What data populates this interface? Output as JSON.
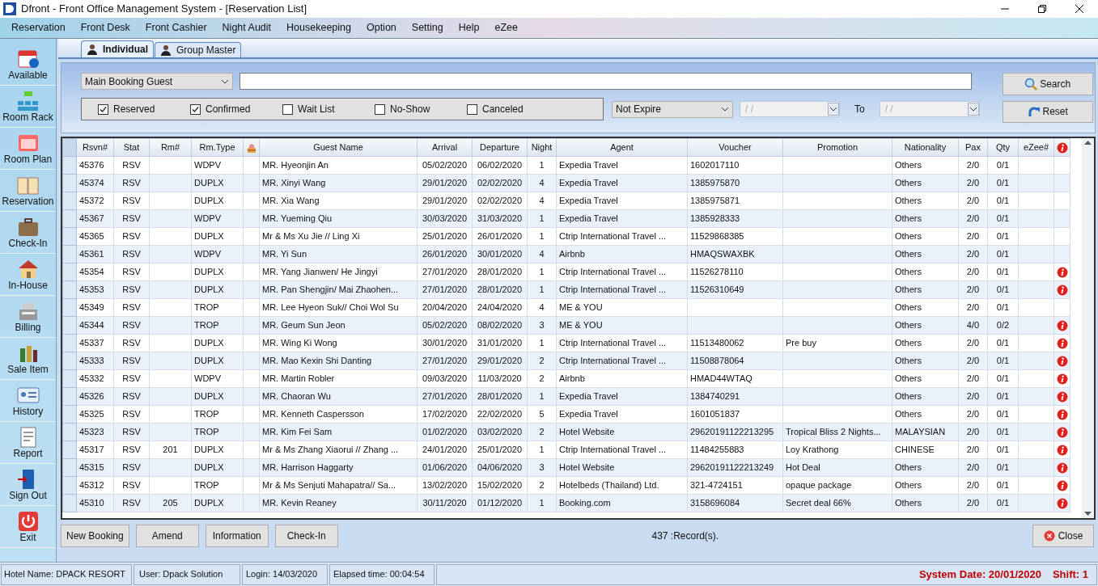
{
  "window": {
    "title": "Dfront - Front Office Management System - [Reservation List]"
  },
  "menu": [
    "Reservation",
    "Front Desk",
    "Front Cashier",
    "Night Audit",
    "Housekeeping",
    "Option",
    "Setting",
    "Help",
    "eZee"
  ],
  "sidebar": [
    "Available",
    "Room Rack",
    "Room Plan",
    "Reservation",
    "Check-In",
    "In-House",
    "Billing",
    "Sale Item",
    "History",
    "Report",
    "Sign Out",
    "Exit"
  ],
  "tabs": [
    {
      "label": "Individual",
      "selected": true
    },
    {
      "label": "Group Master",
      "selected": false
    }
  ],
  "filter": {
    "search_by": "Main Booking Guest",
    "statuses": [
      {
        "label": "Reserved",
        "checked": true
      },
      {
        "label": "Confirmed",
        "checked": true
      },
      {
        "label": "Wait List",
        "checked": false
      },
      {
        "label": "No-Show",
        "checked": false
      },
      {
        "label": "Canceled",
        "checked": false
      }
    ],
    "expiry": "Not Expire",
    "date_from": "/ /",
    "to_label": "To",
    "date_to": "/ /",
    "search_button": "Search",
    "reset_button": "Reset"
  },
  "table": {
    "columns": [
      "Rsvn#",
      "Stat",
      "Rm#",
      "Rm.Type",
      "Guest Name",
      "Arrival",
      "Departure",
      "Night",
      "Agent",
      "Voucher",
      "Promotion",
      "Nationality",
      "Pax",
      "Qty",
      "eZee#"
    ],
    "rows": [
      {
        "cells": [
          "45376",
          "RSV",
          "",
          "WDPV",
          "MR. Hyeonjin An",
          "05/02/2020",
          "06/02/2020",
          "1",
          "Expedia Travel",
          "1602017110",
          "",
          "Others",
          "2/0",
          "0/1",
          ""
        ],
        "alert": false
      },
      {
        "cells": [
          "45374",
          "RSV",
          "",
          "DUPLX",
          "MR. Xinyi Wang",
          "29/01/2020",
          "02/02/2020",
          "4",
          "Expedia Travel",
          "1385975870",
          "",
          "Others",
          "2/0",
          "0/1",
          ""
        ],
        "alert": false
      },
      {
        "cells": [
          "45372",
          "RSV",
          "",
          "DUPLX",
          "MR. Xia Wang",
          "29/01/2020",
          "02/02/2020",
          "4",
          "Expedia Travel",
          "1385975871",
          "",
          "Others",
          "2/0",
          "0/1",
          ""
        ],
        "alert": false
      },
      {
        "cells": [
          "45367",
          "RSV",
          "",
          "WDPV",
          "MR. Yueming Qiu",
          "30/03/2020",
          "31/03/2020",
          "1",
          "Expedia Travel",
          "1385928333",
          "",
          "Others",
          "2/0",
          "0/1",
          ""
        ],
        "alert": false
      },
      {
        "cells": [
          "45365",
          "RSV",
          "",
          "DUPLX",
          "Mr & Ms Xu Jie  // Ling Xi",
          "25/01/2020",
          "26/01/2020",
          "1",
          "Ctrip International Travel ...",
          "11529868385",
          "",
          "Others",
          "2/0",
          "0/1",
          ""
        ],
        "alert": false
      },
      {
        "cells": [
          "45361",
          "RSV",
          "",
          "WDPV",
          "MR. Yi Sun",
          "26/01/2020",
          "30/01/2020",
          "4",
          "Airbnb",
          "HMAQSWAXBK",
          "",
          "Others",
          "2/0",
          "0/1",
          ""
        ],
        "alert": false
      },
      {
        "cells": [
          "45354",
          "RSV",
          "",
          "DUPLX",
          "MR. Yang Jianwen/ He Jingyi",
          "27/01/2020",
          "28/01/2020",
          "1",
          "Ctrip International Travel ...",
          "11526278110",
          "",
          "Others",
          "2/0",
          "0/1",
          ""
        ],
        "alert": true
      },
      {
        "cells": [
          "45353",
          "RSV",
          "",
          "DUPLX",
          "MR. Pan Shengjin/ Mai Zhaohen...",
          "27/01/2020",
          "28/01/2020",
          "1",
          "Ctrip International Travel ...",
          "11526310649",
          "",
          "Others",
          "2/0",
          "0/1",
          ""
        ],
        "alert": true
      },
      {
        "cells": [
          "45349",
          "RSV",
          "",
          "TROP",
          "MR. Lee Hyeon Suk// Choi Wol Su",
          "20/04/2020",
          "24/04/2020",
          "4",
          "ME & YOU",
          "",
          "",
          "Others",
          "2/0",
          "0/1",
          ""
        ],
        "alert": false
      },
      {
        "cells": [
          "45344",
          "RSV",
          "",
          "TROP",
          "MR. Geum Sun Jeon",
          "05/02/2020",
          "08/02/2020",
          "3",
          "ME & YOU",
          "",
          "",
          "Others",
          "4/0",
          "0/2",
          ""
        ],
        "alert": true
      },
      {
        "cells": [
          "45337",
          "RSV",
          "",
          "DUPLX",
          "MR. Wing Ki Wong",
          "30/01/2020",
          "31/01/2020",
          "1",
          "Ctrip International Travel ...",
          "11513480062",
          "Pre buy",
          "Others",
          "2/0",
          "0/1",
          ""
        ],
        "alert": true
      },
      {
        "cells": [
          "45333",
          "RSV",
          "",
          "DUPLX",
          "MR. Mao Kexin Shi Danting",
          "27/01/2020",
          "29/01/2020",
          "2",
          "Ctrip International Travel ...",
          "11508878064",
          "",
          "Others",
          "2/0",
          "0/1",
          ""
        ],
        "alert": true
      },
      {
        "cells": [
          "45332",
          "RSV",
          "",
          "WDPV",
          "MR. Martin Robler",
          "09/03/2020",
          "11/03/2020",
          "2",
          "Airbnb",
          "HMAD44WTAQ",
          "",
          "Others",
          "2/0",
          "0/1",
          ""
        ],
        "alert": true
      },
      {
        "cells": [
          "45326",
          "RSV",
          "",
          "DUPLX",
          "MR. Chaoran Wu",
          "27/01/2020",
          "28/01/2020",
          "1",
          "Expedia Travel",
          "1384740291",
          "",
          "Others",
          "2/0",
          "0/1",
          ""
        ],
        "alert": true
      },
      {
        "cells": [
          "45325",
          "RSV",
          "",
          "TROP",
          "MR. Kenneth Caspersson",
          "17/02/2020",
          "22/02/2020",
          "5",
          "Expedia Travel",
          "1601051837",
          "",
          "Others",
          "2/0",
          "0/1",
          ""
        ],
        "alert": true
      },
      {
        "cells": [
          "45323",
          "RSV",
          "",
          "TROP",
          "MR. Kim Fei Sam",
          "01/02/2020",
          "03/02/2020",
          "2",
          "Hotel Website",
          "29620191122213295",
          "Tropical Bliss 2 Nights...",
          "MALAYSIAN",
          "2/0",
          "0/1",
          ""
        ],
        "alert": true
      },
      {
        "cells": [
          "45317",
          "RSV",
          "201",
          "DUPLX",
          "Mr & Ms Zhang Xiaorui // Zhang ...",
          "24/01/2020",
          "25/01/2020",
          "1",
          "Ctrip International Travel ...",
          "11484255883",
          "Loy Krathong",
          "CHINESE",
          "2/0",
          "0/1",
          ""
        ],
        "alert": true
      },
      {
        "cells": [
          "45315",
          "RSV",
          "",
          "DUPLX",
          "MR. Harrison Haggarty",
          "01/06/2020",
          "04/06/2020",
          "3",
          "Hotel Website",
          "29620191122213249",
          "Hot Deal",
          "Others",
          "2/0",
          "0/1",
          ""
        ],
        "alert": true
      },
      {
        "cells": [
          "45312",
          "RSV",
          "",
          "TROP",
          "Mr & Ms Senjuti Mahapatra// Sa...",
          "13/02/2020",
          "15/02/2020",
          "2",
          "Hotelbeds (Thailand) Ltd.",
          "321-4724151",
          "opaque package",
          "Others",
          "2/0",
          "0/1",
          ""
        ],
        "alert": true
      },
      {
        "cells": [
          "45310",
          "RSV",
          "205",
          "DUPLX",
          "MR. Kevin Reaney",
          "30/11/2020",
          "01/12/2020",
          "1",
          "Booking.com",
          "3158696084",
          "Secret deal 66%",
          "Others",
          "2/0",
          "0/1",
          ""
        ],
        "alert": true
      }
    ]
  },
  "actions": [
    "New Booking",
    "Amend",
    "Information",
    "Check-In"
  ],
  "record_count": "437 :Record(s).",
  "close_button": "Close",
  "status_bar": {
    "hotel": "Hotel Name: DPACK RESORT",
    "user": "User: Dpack Solution",
    "login": "Login: 14/03/2020",
    "elapsed": "Elapsed time: 00:04:54",
    "system_date": "System Date: 20/01/2020",
    "shift": "Shift: 1"
  }
}
